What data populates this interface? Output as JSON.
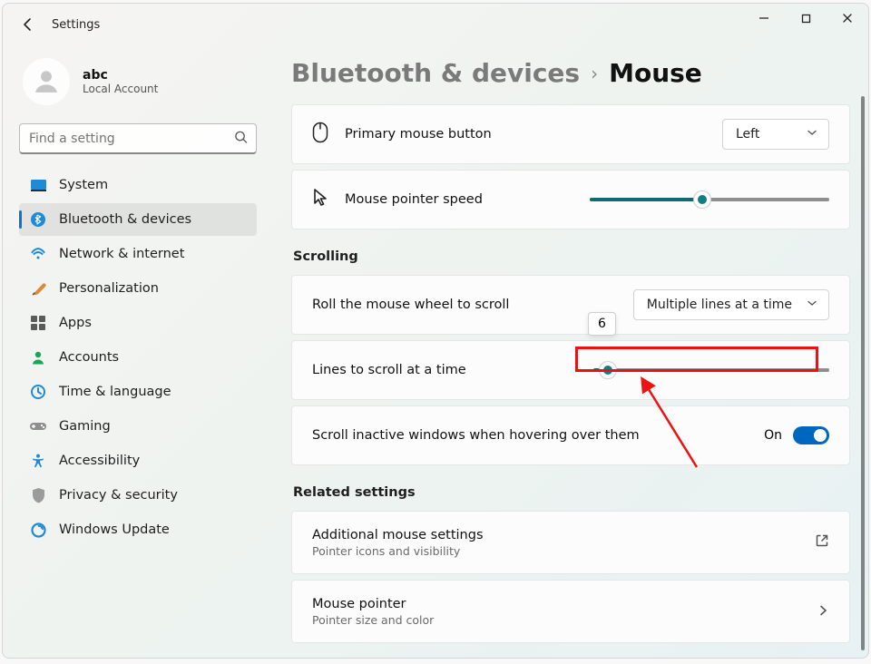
{
  "app": {
    "title": "Settings"
  },
  "user": {
    "name": "abc",
    "subtitle": "Local Account"
  },
  "search": {
    "placeholder": "Find a setting"
  },
  "sidebar": {
    "items": [
      {
        "label": "System"
      },
      {
        "label": "Bluetooth & devices"
      },
      {
        "label": "Network & internet"
      },
      {
        "label": "Personalization"
      },
      {
        "label": "Apps"
      },
      {
        "label": "Accounts"
      },
      {
        "label": "Time & language"
      },
      {
        "label": "Gaming"
      },
      {
        "label": "Accessibility"
      },
      {
        "label": "Privacy & security"
      },
      {
        "label": "Windows Update"
      }
    ]
  },
  "breadcrumb": {
    "parent": "Bluetooth & devices",
    "current": "Mouse"
  },
  "row_primary": {
    "label": "Primary mouse button",
    "value": "Left"
  },
  "row_speed": {
    "label": "Mouse pointer speed",
    "percent": 47
  },
  "sections": {
    "scrolling": "Scrolling",
    "related": "Related settings"
  },
  "row_roll": {
    "label": "Roll the mouse wheel to scroll",
    "value": "Multiple lines at a time"
  },
  "row_lines": {
    "label": "Lines to scroll at a time",
    "percent": 6,
    "tooltip": "6"
  },
  "row_inactive": {
    "label": "Scroll inactive windows when hovering over them",
    "state": "On"
  },
  "row_add": {
    "label": "Additional mouse settings",
    "sub": "Pointer icons and visibility"
  },
  "row_pointer": {
    "label": "Mouse pointer",
    "sub": "Pointer size and color"
  }
}
